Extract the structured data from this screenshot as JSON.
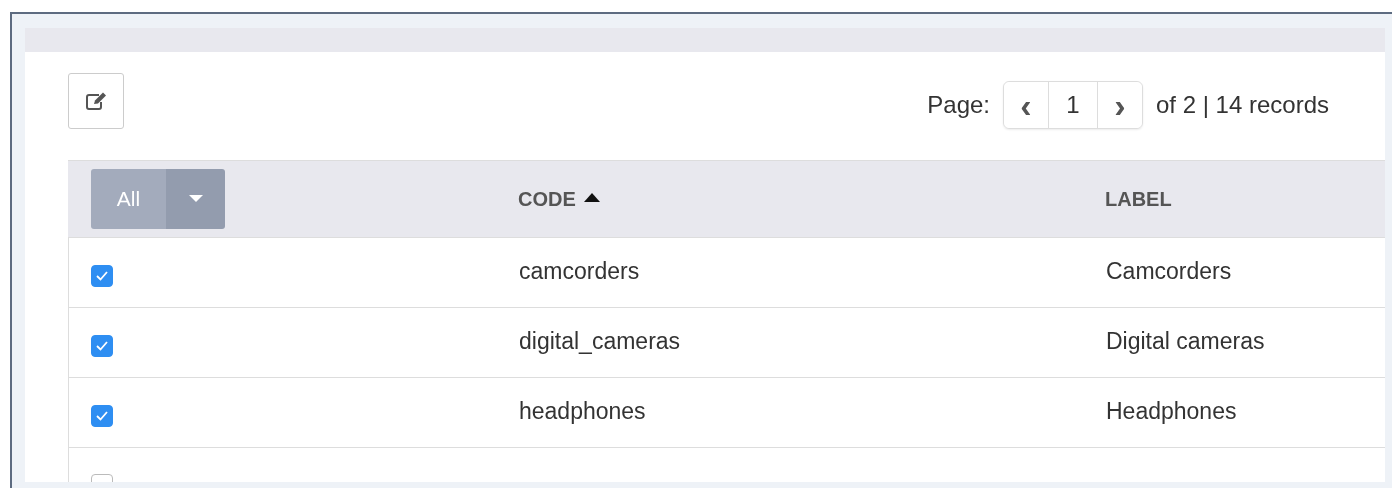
{
  "pagination": {
    "label": "Page:",
    "previous": "‹",
    "current": "1",
    "next": "›",
    "summary": "of 2 | 14 records"
  },
  "table": {
    "select_all": {
      "label": "All"
    },
    "columns": [
      {
        "label": "CODE",
        "sorted": true
      },
      {
        "label": "LABEL",
        "sorted": false
      }
    ],
    "rows": [
      {
        "checked": true,
        "cells": [
          "camcorders",
          "Camcorders"
        ]
      },
      {
        "checked": true,
        "cells": [
          "digital_cameras",
          "Digital cameras"
        ]
      },
      {
        "checked": true,
        "cells": [
          "headphones",
          "Headphones"
        ]
      },
      {
        "checked": false
      }
    ]
  }
}
